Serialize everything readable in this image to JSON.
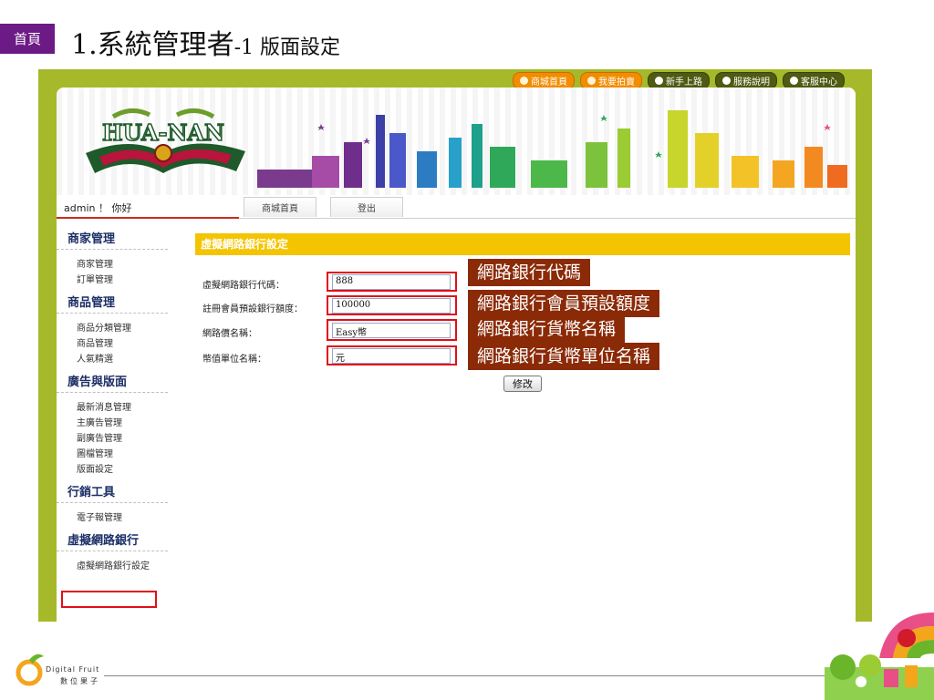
{
  "slide": {
    "home_badge": "首頁",
    "title_main": "1.系統管理者",
    "title_suffix": "-1 版面設定"
  },
  "topnav": [
    {
      "label": "商城首頁",
      "icon": "home-icon",
      "style": "orange"
    },
    {
      "label": "我要拍賣",
      "icon": "auction-icon",
      "style": "orange"
    },
    {
      "label": "新手上路",
      "icon": "user-icon",
      "style": "dark"
    },
    {
      "label": "服務說明",
      "icon": "book-icon",
      "style": "dark"
    },
    {
      "label": "客服中心",
      "icon": "chat-icon",
      "style": "dark"
    }
  ],
  "banner": {
    "logo_text": "HUA-NAN"
  },
  "userbar": {
    "greeting": "admin ！ 你好",
    "tab_home": "商城首頁",
    "tab_logout": "登出"
  },
  "sidebar": [
    {
      "title": "商家管理",
      "items": [
        "商家管理",
        "訂單管理"
      ]
    },
    {
      "title": "商品管理",
      "items": [
        "商品分類管理",
        "商品管理",
        "人氣精選"
      ]
    },
    {
      "title": "廣告與版面",
      "items": [
        "最新消息管理",
        "主廣告管理",
        "副廣告管理",
        "圖檔管理",
        "版面設定"
      ]
    },
    {
      "title": "行銷工具",
      "items": [
        "電子報管理"
      ]
    },
    {
      "title": "虛擬網路銀行",
      "items": [
        "虛擬網路銀行設定"
      ]
    }
  ],
  "panel": {
    "header": "虛擬網路銀行設定",
    "fields": [
      {
        "label": "虛擬網路銀行代碼：",
        "value": "888"
      },
      {
        "label": "註冊會員預設銀行額度：",
        "value": "100000"
      },
      {
        "label": "網路價名稱：",
        "value": "Easy幣"
      },
      {
        "label": "幣值單位名稱：",
        "value": "元"
      }
    ],
    "submit_label": "修改"
  },
  "callouts": [
    "網路銀行代碼",
    "網路銀行會員預設額度",
    "網路銀行貨幣名稱",
    "網路銀行貨幣單位名稱"
  ],
  "footer": {
    "brand_en": "Digital Fruit",
    "brand_zh": "數位果子"
  },
  "colors": {
    "accent_purple": "#6b1a86",
    "frame_green": "#a6b92a",
    "panel_yellow": "#f4c400",
    "callout_brown": "#8b2a07",
    "highlight_red": "#e0101a",
    "nav_orange": "#f28c00"
  }
}
